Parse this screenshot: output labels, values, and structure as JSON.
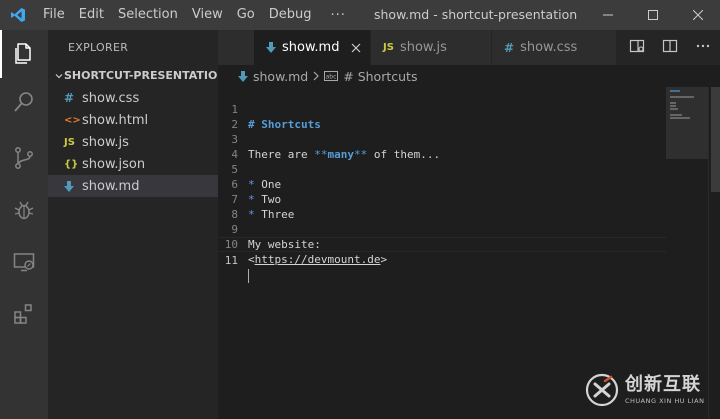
{
  "titlebar": {
    "menu": [
      "File",
      "Edit",
      "Selection",
      "View",
      "Go",
      "Debug"
    ],
    "more": "···",
    "window_title": "show.md - shortcut-presentation [Ad..."
  },
  "activitybar": {
    "icons": [
      "explorer-icon",
      "search-icon",
      "source-control-icon",
      "debug-icon",
      "remote-explorer-icon",
      "extensions-icon"
    ]
  },
  "sidebar": {
    "title": "EXPLORER",
    "section": "SHORTCUT-PRESENTATION",
    "files": [
      {
        "name": "show.css",
        "icon": "#",
        "color": "#519aba"
      },
      {
        "name": "show.html",
        "icon": "<>",
        "color": "#e37933"
      },
      {
        "name": "show.js",
        "icon": "JS",
        "color": "#cbcb41"
      },
      {
        "name": "show.json",
        "icon": "{}",
        "color": "#cbcb41"
      },
      {
        "name": "show.md",
        "icon": "markdown",
        "color": "#519aba",
        "selected": true
      }
    ]
  },
  "tabs": [
    {
      "label": "show.md",
      "active": true
    },
    {
      "label": "show.js",
      "active": false
    },
    {
      "label": "show.css",
      "active": false
    }
  ],
  "breadcrumb": {
    "file": "show.md",
    "symbol": "# Shortcuts"
  },
  "editor": {
    "lines": [
      {
        "n": "1",
        "text": "# Shortcuts"
      },
      {
        "n": "2",
        "text": ""
      },
      {
        "n": "3",
        "prefix": "There are ",
        "bold_open": "**",
        "bold": "many",
        "bold_close": "**",
        "suffix": " of them..."
      },
      {
        "n": "4",
        "text": ""
      },
      {
        "n": "5",
        "bullet": "*",
        "text": " One"
      },
      {
        "n": "6",
        "bullet": "*",
        "text": " Two"
      },
      {
        "n": "7",
        "bullet": "*",
        "text": " Three"
      },
      {
        "n": "8",
        "text": ""
      },
      {
        "n": "9",
        "text": "My website:"
      },
      {
        "n": "10",
        "open": "<",
        "link": "https://devmount.de",
        "close": ">"
      },
      {
        "n": "11",
        "text": ""
      }
    ],
    "current_line": "11"
  },
  "watermark": {
    "main": "创新互联",
    "sub": "CHUANG XIN HU LIAN"
  },
  "colors": {
    "accent": "#007acc",
    "titlebar": "#3c3c3c",
    "sidebar": "#252526",
    "editor": "#1e1e1e"
  }
}
